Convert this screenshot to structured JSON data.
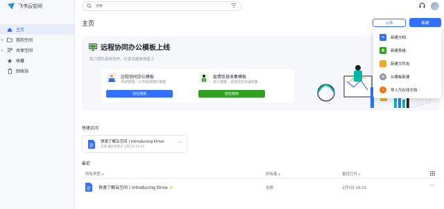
{
  "app": {
    "name": "飞书云空间"
  },
  "sidebar": {
    "items": [
      {
        "label": "主页",
        "icon": "home-icon",
        "active": true
      },
      {
        "label": "我的空间",
        "icon": "folder-icon",
        "expandable": true
      },
      {
        "label": "共享空间",
        "icon": "shared-users-icon",
        "expandable": true
      },
      {
        "label": "收藏",
        "icon": "star-icon"
      },
      {
        "label": "回收站",
        "icon": "trash-icon"
      }
    ]
  },
  "search": {
    "placeholder": "搜索"
  },
  "main": {
    "title": "主页",
    "upload_label": "上传",
    "new_label": "新建"
  },
  "banner": {
    "title": "远程协同办公模板上线",
    "subtitle": "助力团队高效协作，在家也能愉快复工",
    "cards": [
      {
        "title": "远程协同办公模板",
        "desc": "项目管理、工作进展随时掌握",
        "button": "前往使用"
      },
      {
        "title": "疫情信息收集模板",
        "desc": "员工健康，返岗信息快速收集",
        "button": "前往使用"
      }
    ]
  },
  "quick_access": {
    "label": "快速访问",
    "items": [
      {
        "title": "快速了解云空间 | Introducing Drive",
        "meta": "志明 最近更新于 2月5日 16:01"
      }
    ]
  },
  "recent": {
    "label": "最近",
    "columns": {
      "type": "所有类型",
      "owner": "所有者",
      "opened": "最近打开"
    },
    "rows": [
      {
        "name": "快速了解云空间 | Introducing Drive",
        "owner": "志明",
        "opened": "2月5日 16:01"
      }
    ]
  },
  "new_menu": {
    "items": [
      {
        "label": "新建文档",
        "icon": "doc-icon",
        "color": "#3370ff"
      },
      {
        "label": "新建表格",
        "icon": "sheet-icon",
        "color": "#2ea121"
      },
      {
        "label": "新建文件夹",
        "icon": "folder-icon",
        "color": "#f5a623"
      },
      {
        "label": "从模板新建",
        "icon": "template-icon",
        "color": "#8f959e"
      },
      {
        "label": "导入为在线文档",
        "icon": "import-icon",
        "color": "#f5720b"
      }
    ]
  },
  "colors": {
    "accent": "#3370ff",
    "green": "#2ea121",
    "sidebar_bg": "#f7f8fa"
  }
}
